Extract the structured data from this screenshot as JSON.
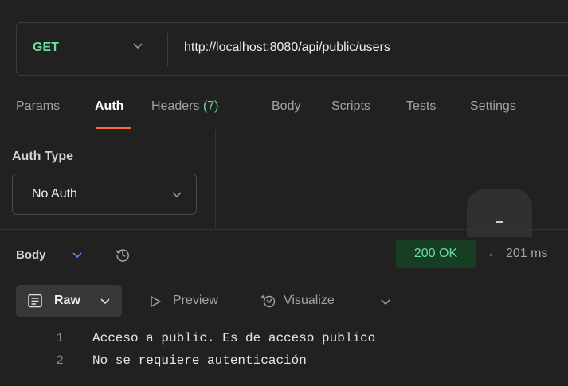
{
  "request": {
    "method": "GET",
    "url": "http://localhost:8080/api/public/users"
  },
  "tabs": [
    {
      "label": "Params"
    },
    {
      "label": "Auth"
    },
    {
      "label": "Headers",
      "count": "(7)"
    },
    {
      "label": "Body"
    },
    {
      "label": "Scripts"
    },
    {
      "label": "Tests"
    },
    {
      "label": "Settings"
    }
  ],
  "active_tab": "Auth",
  "auth": {
    "type_label": "Auth Type",
    "type_value": "No Auth"
  },
  "response": {
    "section_label": "Body",
    "status": "200 OK",
    "separator": "•",
    "time": "201 ms",
    "view": {
      "raw_label": "Raw",
      "preview_label": "Preview",
      "visualize_label": "Visualize"
    },
    "lines": [
      {
        "no": "1",
        "text": "Acceso a public. Es de acceso publico"
      },
      {
        "no": "2",
        "text": "No se requiere autenticación"
      }
    ]
  },
  "icons": {
    "method_dropdown": "chevron-down-icon",
    "auth_dropdown": "chevron-down-icon",
    "body_dropdown": "chevron-down-icon",
    "history": "history-icon",
    "raw": "raw-format-icon",
    "preview": "play-outline-icon",
    "visualize": "visualize-icon"
  },
  "colors": {
    "background": "#212121",
    "method_green": "#6bdd9a",
    "active_tab_underline": "#ff6c37",
    "status_bg": "#173d23",
    "status_text": "#6bdd9a",
    "body_chevron": "#5b8cff"
  }
}
